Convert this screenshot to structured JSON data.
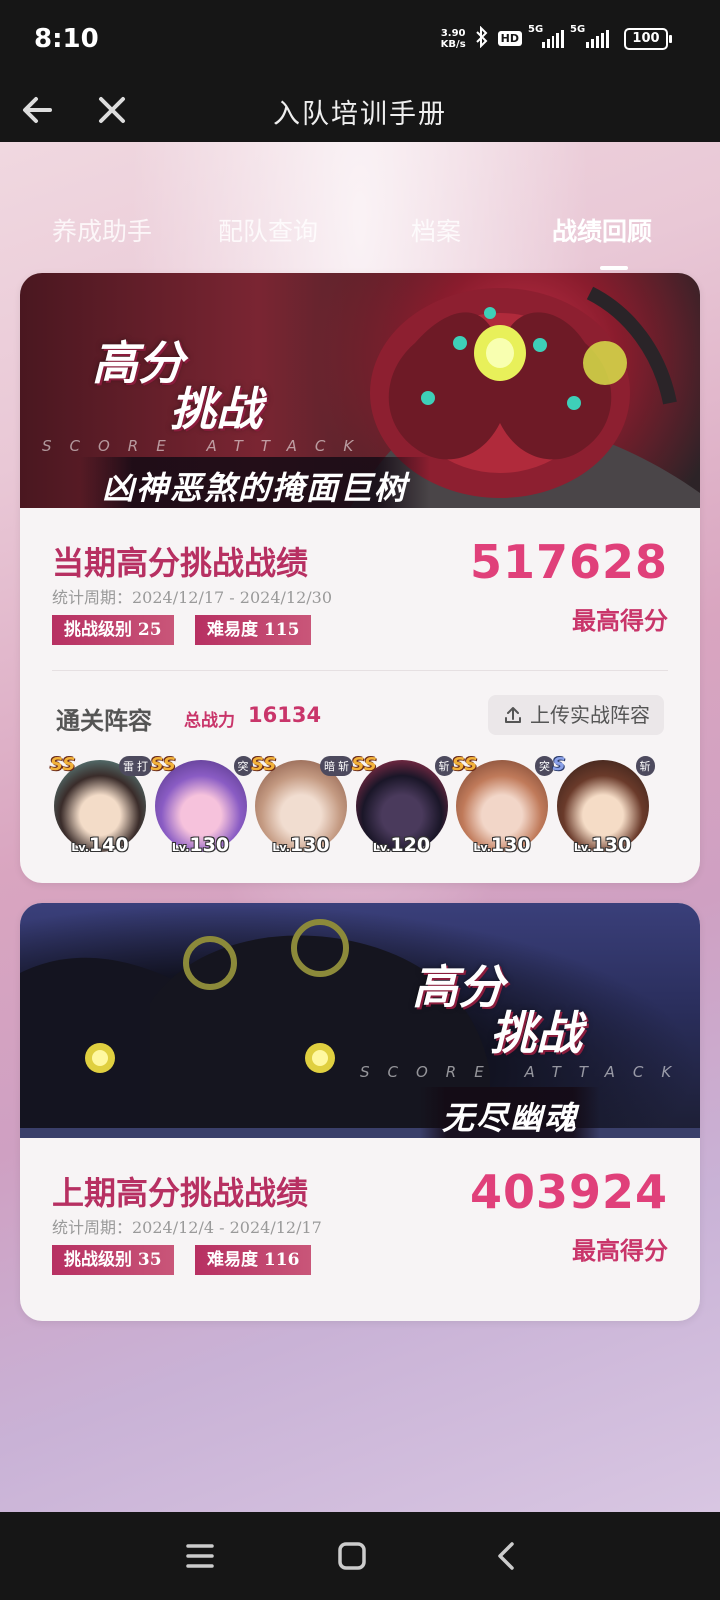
{
  "status_bar": {
    "time": "8:10",
    "net_speed_value": "3.90",
    "net_speed_unit": "KB/s",
    "hd_badge": "HD",
    "signal1_label": "5G",
    "signal2_label": "5G",
    "battery": "100"
  },
  "header": {
    "title": "入队培训手册",
    "back_icon": "back-arrow-icon",
    "close_icon": "close-icon"
  },
  "tabs": [
    {
      "label": "养成助手",
      "active": false
    },
    {
      "label": "配队查询",
      "active": false
    },
    {
      "label": "档案",
      "active": false
    },
    {
      "label": "战绩回顾",
      "active": true
    }
  ],
  "current": {
    "banner_title_line1": "高分",
    "banner_title_line2": "挑战",
    "banner_subtitle": "SCORE ATTACK",
    "boss_name": "凶神恶煞的掩面巨树",
    "record_title": "当期高分挑战战绩",
    "period": "统计周期：2024/12/17 - 2024/12/30",
    "level_tag": "挑战级别 25",
    "difficulty_tag": "难易度 115",
    "score": "517628",
    "score_label": "最高得分",
    "team_label": "通关阵容",
    "power_label": "总战力",
    "power_value": "16134",
    "upload_label": "上传实战阵容",
    "team": [
      {
        "rank": "SS",
        "attrs": [
          "雷",
          "打"
        ],
        "lv_prefix": "Lv.",
        "lv": "140",
        "colors": [
          "#f3dcc8",
          "#3a2c2a",
          "#6ba9a8"
        ]
      },
      {
        "rank": "SS",
        "attrs": [
          "突"
        ],
        "lv_prefix": "Lv.",
        "lv": "130",
        "colors": [
          "#f6c2dc",
          "#8a5cc4",
          "#4b2f7a"
        ]
      },
      {
        "rank": "SS",
        "attrs": [
          "暗",
          "斩"
        ],
        "lv_prefix": "Lv.",
        "lv": "130",
        "colors": [
          "#f1ddd0",
          "#c49a82",
          "#7a4a3a"
        ]
      },
      {
        "rank": "SS",
        "attrs": [
          "斩"
        ],
        "lv_prefix": "Lv.",
        "lv": "120",
        "colors": [
          "#4a3a5c",
          "#1a1628",
          "#c43a5a"
        ]
      },
      {
        "rank": "SS",
        "attrs": [
          "突"
        ],
        "lv_prefix": "Lv.",
        "lv": "130",
        "colors": [
          "#f2d6c8",
          "#c07a5a",
          "#6a3a2a"
        ]
      },
      {
        "rank": "S",
        "attrs": [
          "斩"
        ],
        "lv_prefix": "Lv.",
        "lv": "130",
        "colors": [
          "#f5dcc6",
          "#6a3a2a",
          "#2a1a16"
        ]
      }
    ]
  },
  "previous": {
    "banner_title_line1": "高分",
    "banner_title_line2": "挑战",
    "banner_subtitle": "SCORE ATTACK",
    "boss_name": "无尽幽魂",
    "record_title": "上期高分挑战战绩",
    "period": "统计周期：2024/12/4 - 2024/12/17",
    "level_tag": "挑战级别 35",
    "difficulty_tag": "难易度 116",
    "score": "403924",
    "score_label": "最高得分"
  },
  "nav_bar": {
    "menu_icon": "menu-icon",
    "home_icon": "home-icon",
    "back_icon": "back-icon"
  }
}
